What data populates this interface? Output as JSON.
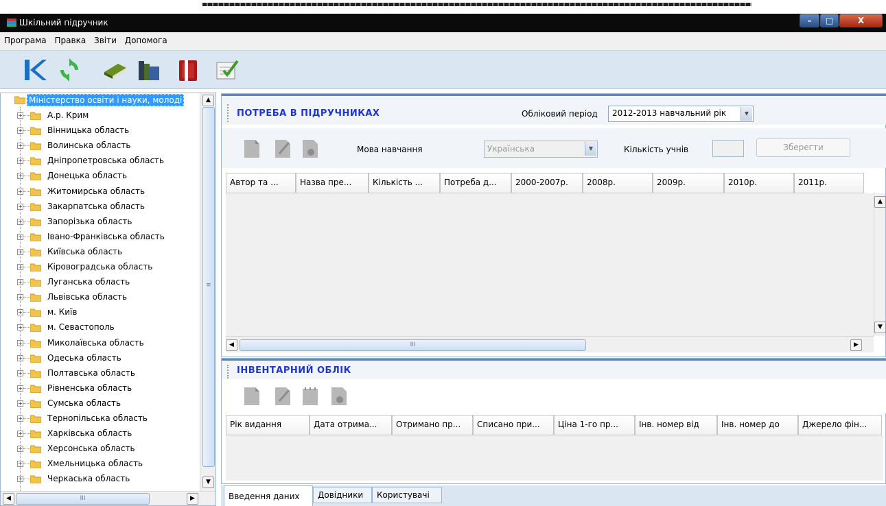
{
  "window": {
    "title": "Шкільний підручник",
    "controls": {
      "minimize": "–",
      "maximize": "□",
      "close": "X"
    }
  },
  "menu": [
    "Програма",
    "Правка",
    "Звіти",
    "Допомога"
  ],
  "toolbar": {
    "icons": [
      "k-logo-icon",
      "refresh-icon",
      "book-icon",
      "books-stack-icon",
      "red-folder-icon",
      "checklist-icon"
    ]
  },
  "sidebar": {
    "root": "Міністерство освіти і науки, молоді",
    "items": [
      "А.р. Крим",
      "Вінницька область",
      "Волинська область",
      "Дніпропетровська область",
      "Донецька область",
      "Житомирська область",
      "Закарпатська область",
      "Запорізька область",
      "Івано-Франківська область",
      "Київська область",
      "Кіровоградська область",
      "Луганська область",
      "Львівська область",
      "м. Київ",
      "м. Севастополь",
      "Миколаївська область",
      "Одеська область",
      "Полтавська область",
      "Рівненська область",
      "Сумська область",
      "Тернопільська область",
      "Харківська область",
      "Херсонська область",
      "Хмельницька область",
      "Черкаська область"
    ],
    "scroll_thumb_glyph": "III",
    "vscroll_grip_glyph": "≡"
  },
  "needs": {
    "title": "ПОТРЕБА В ПІДРУЧНИКАХ",
    "period_label": "Обліковий період",
    "period_value": "2012-2013 навчальний рік",
    "language_label": "Мова навчання",
    "language_value": "Українська",
    "students_label": "Кількість учнів",
    "students_value": "",
    "save_button": "Зберегти",
    "columns": [
      "Автор та ...",
      "Назва пре...",
      "Кількість ...",
      "Потреба д...",
      "2000-2007р.",
      "2008р.",
      "2009р.",
      "2010р.",
      "2011р."
    ],
    "scroll_thumb_glyph": "III"
  },
  "inventory": {
    "title": "ІНВЕНТАРНИЙ ОБЛІК",
    "columns": [
      "Рік видання",
      "Дата отрима...",
      "Отримано пр...",
      "Списано при...",
      "Ціна 1-го пр...",
      "Інв. номер від",
      "Інв. номер до",
      "Джерело фін..."
    ]
  },
  "tabs": [
    "Введення даних",
    "Довідники",
    "Користувачі"
  ]
}
